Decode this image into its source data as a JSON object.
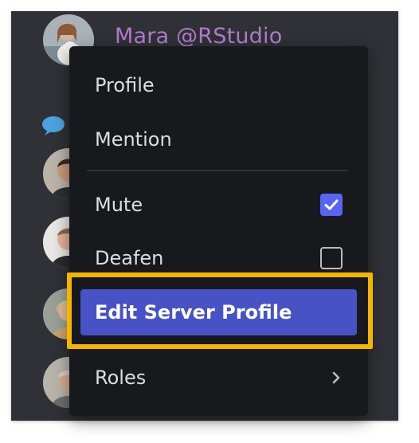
{
  "user": {
    "display_name": "Mara @RStudio"
  },
  "context_menu": {
    "items": [
      {
        "label": "Profile"
      },
      {
        "label": "Mention"
      },
      {
        "label": "Mute",
        "checked": true
      },
      {
        "label": "Deafen",
        "checked": false
      },
      {
        "label": "Edit Server Profile",
        "highlighted": true
      },
      {
        "label": "Roles",
        "has_submenu": true
      }
    ]
  },
  "colors": {
    "background": "#2f3136",
    "menu_background": "#18191c",
    "username": "#b07cc8",
    "accent": "#5865f2",
    "highlight_item": "#4752c4",
    "annotation_frame": "#f4b400"
  },
  "icons": {
    "checked": "checkbox-checked-icon",
    "unchecked": "checkbox-unchecked-icon",
    "submenu": "chevron-right-icon",
    "channel": "speech-bubble-icon"
  }
}
